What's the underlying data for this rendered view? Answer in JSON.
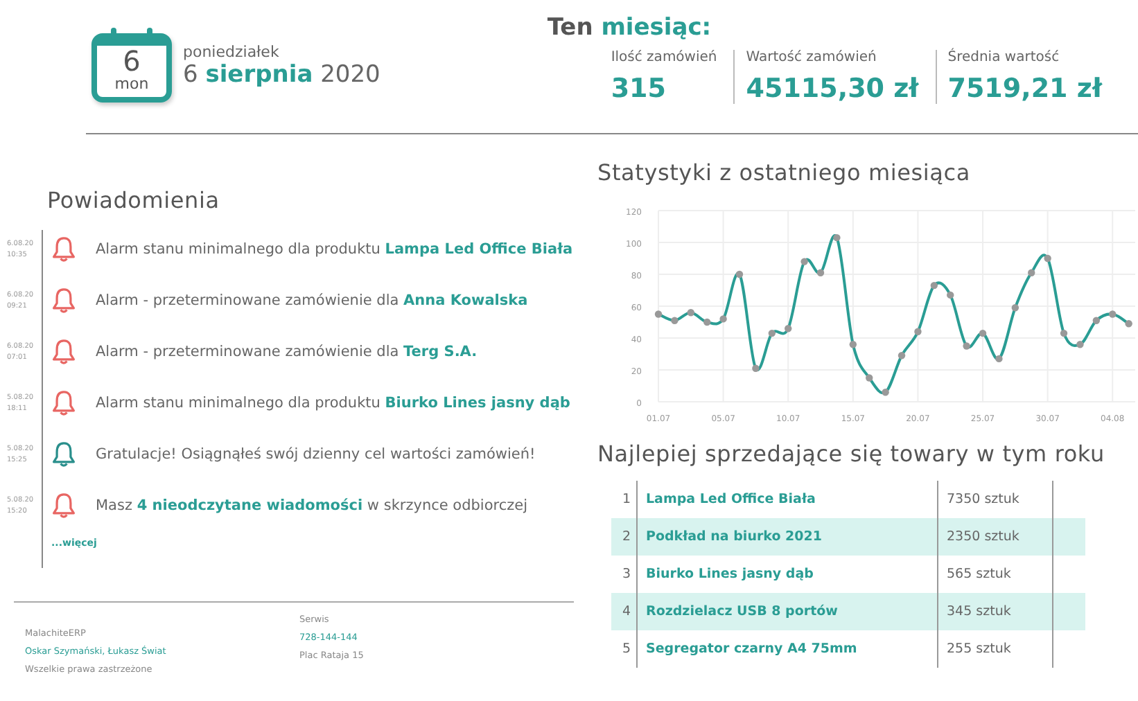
{
  "date": {
    "day": "6",
    "weekday_short": "mon",
    "weekday": "poniedziałek",
    "day_text": "6",
    "month": "sierpnia",
    "year": "2020"
  },
  "month_stats": {
    "title": "Ten",
    "title_accent": "miesiąc:",
    "items": [
      {
        "label": "Ilość zamówień",
        "value": "315"
      },
      {
        "label": "Wartość zamówień",
        "value": "45115,30 zł"
      },
      {
        "label": "Średnia wartość",
        "value": "7519,21 zł"
      }
    ]
  },
  "notifications": {
    "title": "Powiadomienia",
    "items": [
      {
        "date": "6.08.20",
        "time": "10:35",
        "kind": "alarm",
        "text": "Alarm stanu minimalnego dla produktu **Lampa Led Office Biała**"
      },
      {
        "date": "6.08.20",
        "time": "09:21",
        "kind": "alarm",
        "text": "Alarm - przeterminowane zamówienie dla **Anna Kowalska**"
      },
      {
        "date": "6.08.20",
        "time": "07:01",
        "kind": "alarm",
        "text": "Alarm - przeterminowane zamówienie dla **Terg S.A.**"
      },
      {
        "date": "5.08.20",
        "time": "18:11",
        "kind": "alarm",
        "text": "Alarm stanu minimalnego dla produktu **Biurko Lines jasny dąb**"
      },
      {
        "date": "5.08.20",
        "time": "15:25",
        "kind": "success",
        "text": "Gratulacje! Osiągnąłeś swój dzienny cel wartości zamówień!"
      },
      {
        "date": "5.08.20",
        "time": "15:20",
        "kind": "alarm",
        "text": "Masz **4 nieodczytane wiadomości** w skrzynce odbiorczej"
      }
    ],
    "more": "...więcej"
  },
  "footer": {
    "left": [
      "MalachiteERP",
      "Oskar Szymański, Łukasz Świat",
      "Wszelkie prawa zastrzeżone"
    ],
    "right": [
      "Serwis",
      "728-144-144",
      "Plac Rataja 15"
    ]
  },
  "stats": {
    "title": "Statystyki z ostatniego miesiąca",
    "chart_data": {
      "type": "line",
      "ylim": [
        0,
        120
      ],
      "yticks": [
        0,
        20,
        40,
        60,
        80,
        100,
        120
      ],
      "categories": [
        "01.07",
        null,
        null,
        null,
        "05.07",
        null,
        null,
        null,
        "10.07",
        null,
        null,
        null,
        "15.07",
        null,
        null,
        null,
        "20.07",
        null,
        null,
        null,
        "25.07",
        null,
        null,
        null,
        "30.07",
        null,
        null,
        null,
        "04.08",
        null
      ],
      "grid": true,
      "series": [
        {
          "color": "#2a9d94",
          "marker": "circle",
          "values": [
            55,
            51,
            56,
            50,
            52,
            80,
            21,
            43,
            46,
            88,
            81,
            103,
            36,
            15,
            6,
            29,
            44,
            73,
            67,
            35,
            43,
            27,
            59,
            81,
            90,
            43,
            36,
            51,
            55,
            49
          ]
        }
      ]
    }
  },
  "top_products": {
    "title": "Najlepiej sprzedające się towary w tym roku",
    "rows": [
      {
        "rank": "1",
        "name": "Lampa Led Office Biała",
        "amount": "7350 sztuk"
      },
      {
        "rank": "2",
        "name": "Podkład na biurko 2021",
        "amount": "2350 sztuk"
      },
      {
        "rank": "3",
        "name": "Biurko Lines jasny dąb",
        "amount": "565 sztuk"
      },
      {
        "rank": "4",
        "name": "Rozdzielacz USB 8 portów",
        "amount": "345 sztuk"
      },
      {
        "rank": "5",
        "name": "Segregator czarny A4 75mm",
        "amount": "255 sztuk"
      }
    ]
  }
}
